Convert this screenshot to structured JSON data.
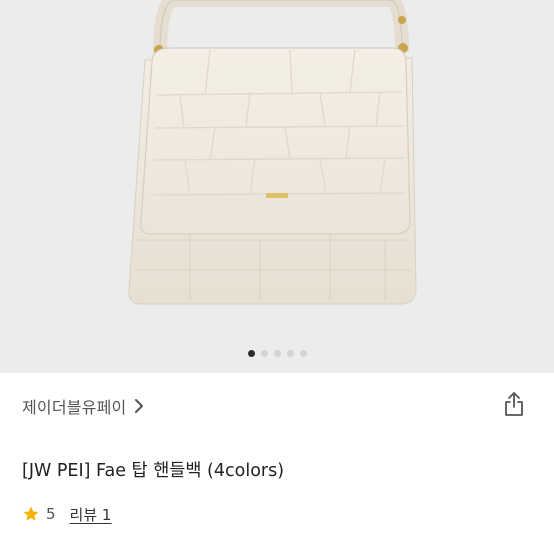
{
  "product": {
    "brand": "제이더블유페이",
    "title": "[JW PEI] Fae 탑 핸들백 (4colors)",
    "rating": "5",
    "reviews_label": "리뷰 1",
    "image": "cream-croc-embossed-handbag",
    "carousel": {
      "count": 5,
      "active_index": 0
    }
  },
  "icons": {
    "brand_chevron": "chevron-right-icon",
    "share": "share-icon",
    "rating": "star-icon"
  },
  "colors": {
    "star": "#f4b400",
    "active_dot": "#2b2b2b",
    "inactive_dot": "#d3d3d3",
    "hero_background": "#ececec",
    "bag_body": "#ece6da"
  }
}
